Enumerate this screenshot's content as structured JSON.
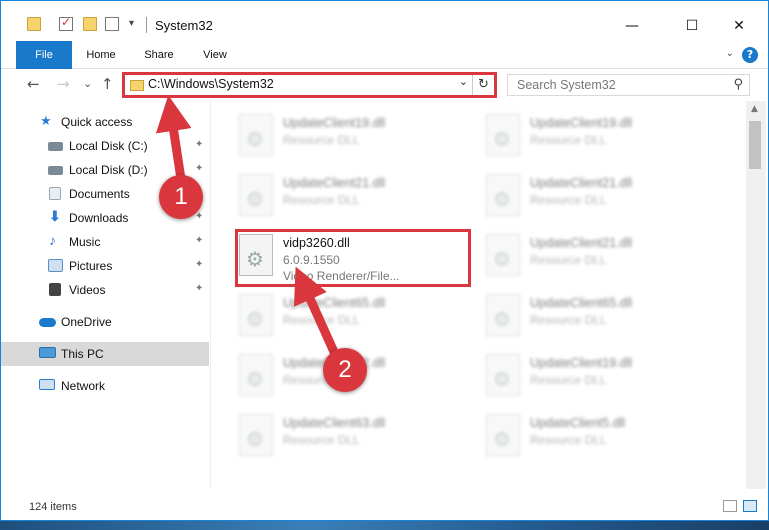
{
  "window": {
    "title": "System32",
    "minimize": "—",
    "maximize": "☐",
    "close": "✕"
  },
  "ribbon": {
    "tabs": [
      "File",
      "Home",
      "Share",
      "View"
    ],
    "toggle": "⌄",
    "help": "?"
  },
  "navigation": {
    "back": "←",
    "forward": "→",
    "recent": "⌄",
    "up": "↑",
    "address": "C:\\Windows\\System32",
    "address_dropdown": "⌄",
    "refresh": "↻",
    "search_placeholder": "Search System32",
    "search_icon": "⚲"
  },
  "sidebar": {
    "items": [
      {
        "label": "Quick access",
        "icon": "star-icon",
        "color": "#2b7cd3"
      },
      {
        "label": "Local Disk (C:)",
        "icon": "drive-icon",
        "color": "#7a8a99",
        "pinned": true
      },
      {
        "label": "Local Disk (D:)",
        "icon": "drive-icon",
        "color": "#7a8a99",
        "pinned": true
      },
      {
        "label": "Documents",
        "icon": "documents-icon",
        "color": "#9aa7b4",
        "pinned": true
      },
      {
        "label": "Downloads",
        "icon": "downloads-icon",
        "color": "#2b7cd3",
        "pinned": true
      },
      {
        "label": "Music",
        "icon": "music-icon",
        "color": "#2b7cd3",
        "pinned": true
      },
      {
        "label": "Pictures",
        "icon": "pictures-icon",
        "color": "#5a8fc4",
        "pinned": true
      },
      {
        "label": "Videos",
        "icon": "videos-icon",
        "color": "#444444",
        "pinned": true
      },
      {
        "label": "OneDrive",
        "icon": "cloud-icon",
        "color": "#1979ca"
      },
      {
        "label": "This PC",
        "icon": "computer-icon",
        "color": "#4a9ad8",
        "selected": true
      },
      {
        "label": "Network",
        "icon": "network-icon",
        "color": "#2b7cd3"
      }
    ],
    "pin_glyph": "📌"
  },
  "files": {
    "left": [
      {
        "name": "UpdateClient19.dll",
        "type": "Resource DLL"
      },
      {
        "name": "UpdateClient21.dll",
        "type": "Resource DLL"
      },
      {
        "name": "vidp3260.dll",
        "version": "6.0.9.1550",
        "description": "Video Renderer/File..."
      },
      {
        "name": "UpdateClient65.dll",
        "type": "Resource DLL"
      },
      {
        "name": "UpdateClient42.dll",
        "type": "Resource DLL"
      },
      {
        "name": "UpdateClient63.dll",
        "type": "Resource DLL"
      }
    ],
    "right": [
      {
        "name": "UpdateClient19.dll",
        "type": "Resource DLL"
      },
      {
        "name": "UpdateClient21.dll",
        "type": "Resource DLL"
      },
      {
        "name": "UpdateClient21.dll",
        "type": "Resource DLL"
      },
      {
        "name": "UpdateClient65.dll",
        "type": "Resource DLL"
      },
      {
        "name": "UpdateClient19.dll",
        "type": "Resource DLL"
      },
      {
        "name": "UpdateClient5.dll",
        "type": "Resource DLL"
      }
    ]
  },
  "status": {
    "item_count": "124 items"
  },
  "annotations": {
    "step1": "1",
    "step2": "2",
    "color": "#d9363e"
  }
}
